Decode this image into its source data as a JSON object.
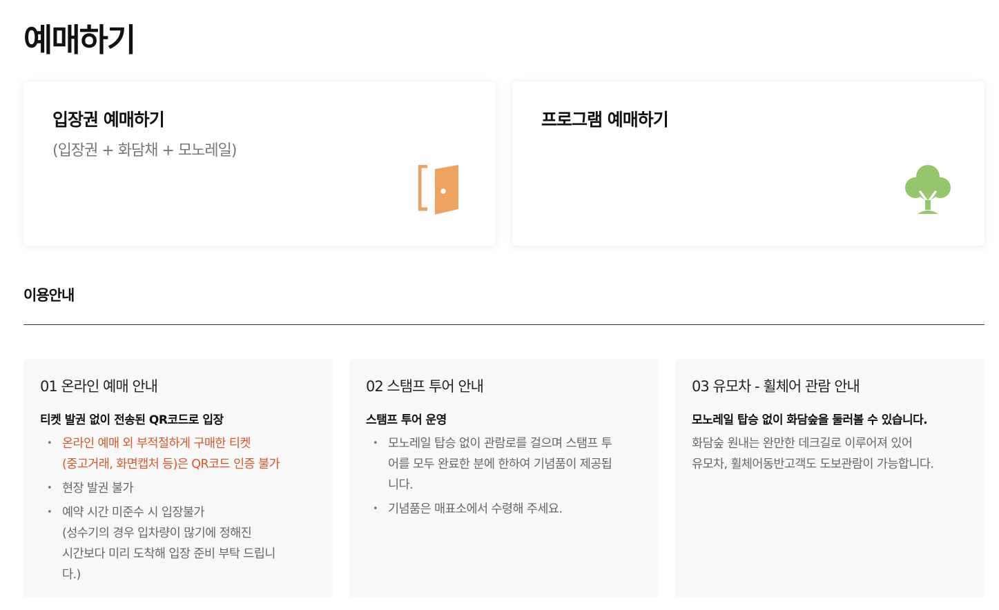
{
  "page": {
    "title": "예매하기"
  },
  "cards": [
    {
      "title": "입장권 예매하기",
      "subtitle": "(입장권 + 화담채 + 모노레일)",
      "icon": "door-icon",
      "icon_color": "#eda35f"
    },
    {
      "title": "프로그램 예매하기",
      "subtitle": "",
      "icon": "tree-icon",
      "icon_color": "#94c76a"
    }
  ],
  "usage": {
    "title": "이용안내",
    "boxes": [
      {
        "title": "01 온라인 예매 안내",
        "subtitle": "티켓 발권 없이 전송된 QR코드로 입장",
        "items": [
          {
            "lines": [
              "온라인 예매 외 부적절하게 구매한 티켓",
              "(중고거래, 화면캡처 등)은 QR코드 인증 불가"
            ],
            "highlight": true
          },
          {
            "lines": [
              "현장 발권 불가"
            ],
            "highlight": false
          },
          {
            "lines": [
              "예약 시간 미준수 시 입장불가",
              "(성수기의 경우 입차량이 많기에 정해진",
              "시간보다 미리 도착해 입장 준비 부탁 드립니",
              "다.)"
            ],
            "highlight": false
          }
        ]
      },
      {
        "title": "02 스탬프 투어 안내",
        "subtitle": "스탬프 투어 운영",
        "items": [
          {
            "lines": [
              "모노레일 탑승 없이 관람로를 걸으며 스탬프 투",
              "어를 모두 완료한 분에 한하여 기념품이 제공됩",
              "니다."
            ],
            "highlight": false
          },
          {
            "lines": [
              "기념품은 매표소에서 수령해 주세요."
            ],
            "highlight": false
          }
        ]
      },
      {
        "title": "03 유모차 - 휠체어 관람 안내",
        "subtitle": "모노레일 탑승 없이 화담숲을 둘러볼 수 있습니다.",
        "text_lines": [
          "화담숲 원내는 완만한 데크길로 이루어져 있어",
          "유모차, 휠체어동반고객도 도보관람이 가능합니다."
        ]
      }
    ]
  },
  "colors": {
    "accent_orange": "#eda35f",
    "accent_green": "#94c76a",
    "warning_text": "#d4582c"
  }
}
